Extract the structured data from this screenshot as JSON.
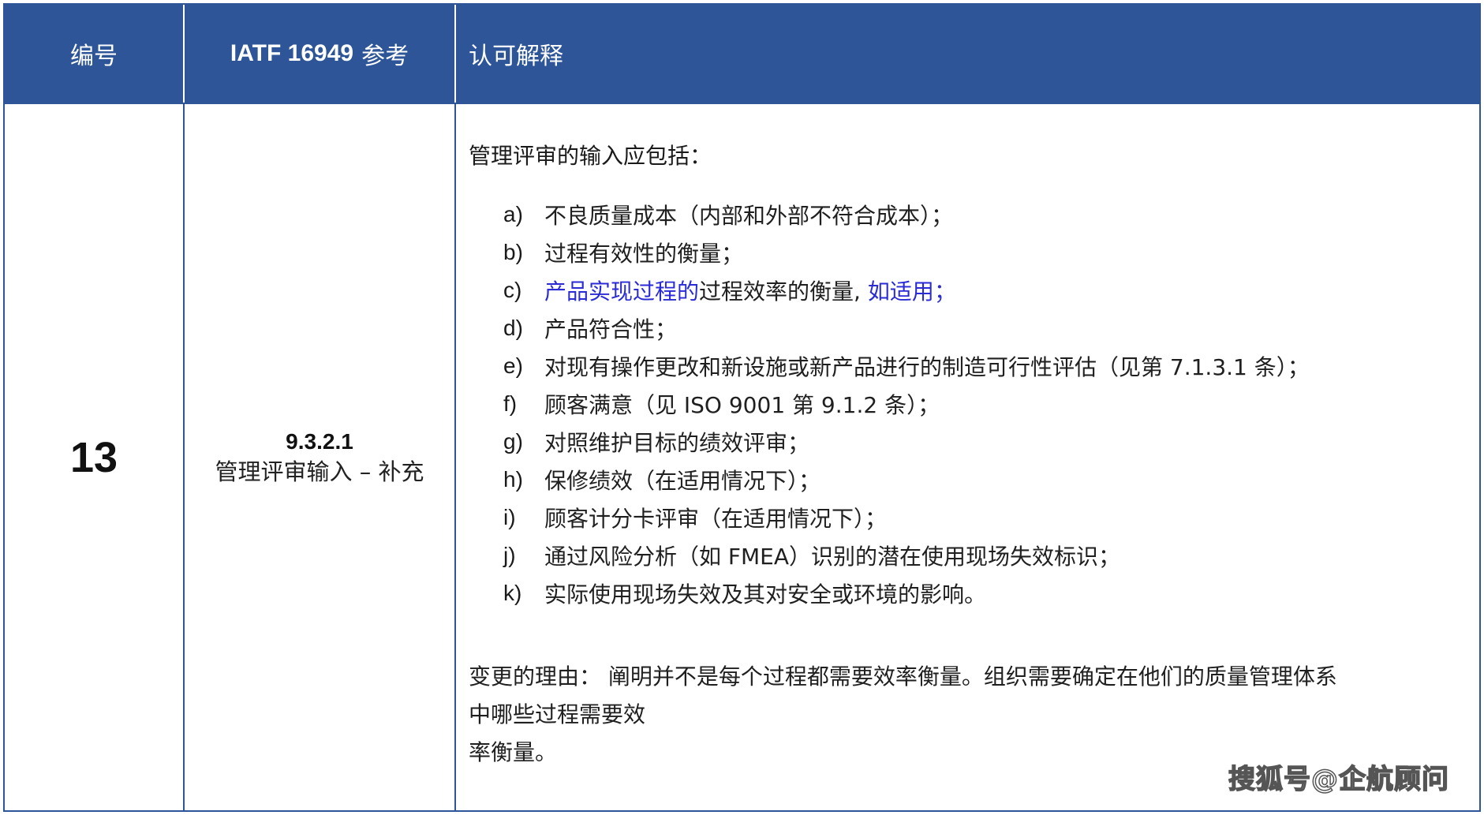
{
  "header": {
    "col_number": "编号",
    "col_ref_bold": "IATF 16949",
    "col_ref_rest": "参考",
    "col_explanation": "认可解释"
  },
  "row": {
    "number": "13",
    "clause": "9.3.2.1",
    "clause_title": "管理评审输入 – 补充",
    "intro": "管理评审的输入应包括：",
    "items": [
      {
        "label": "a)",
        "text": "不良质量成本（内部和外部不符合成本）；"
      },
      {
        "label": "b)",
        "text": "过程有效性的衡量；"
      },
      {
        "label": "c)",
        "text_blue_1": "产品实现过程的",
        "text_mid": "过程效率的衡量,",
        "text_blue_2": "如适用；"
      },
      {
        "label": "d)",
        "text": "产品符合性；"
      },
      {
        "label": "e)",
        "text": "对现有操作更改和新设施或新产品进行的制造可行性评估（见第 7.1.3.1 条）；"
      },
      {
        "label": "f)",
        "text": "顾客满意（见 ISO 9001 第 9.1.2 条）；"
      },
      {
        "label": "g)",
        "text": "对照维护目标的绩效评审；"
      },
      {
        "label": "h)",
        "text": "保修绩效（在适用情况下）；"
      },
      {
        "label": "i)",
        "text": "顾客计分卡评审（在适用情况下）；"
      },
      {
        "label": "j)",
        "text": "通过风险分析（如 FMEA）识别的潜在使用现场失效标识；"
      },
      {
        "label": "k)",
        "text": "实际使用现场失效及其对安全或环境的影响。"
      }
    ],
    "reason_line1": "变更的理由： 阐明并不是每个过程都需要效率衡量。组织需要确定在他们的质量管理体系",
    "reason_line2": "中哪些过程需要效",
    "reason_line3": "率衡量。"
  },
  "watermark": "搜狐号@企航顾问",
  "colors": {
    "header_bg": "#2e5597",
    "border": "#2e5597",
    "highlight_text": "#2b2bd6"
  }
}
